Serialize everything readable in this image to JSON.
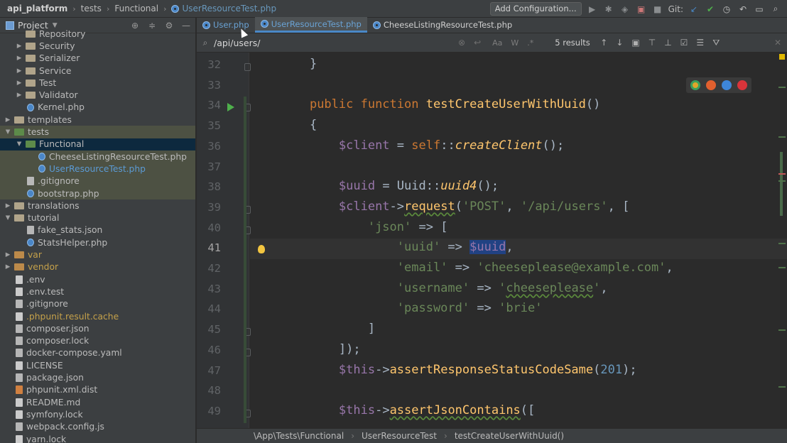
{
  "topbar": {
    "breadcrumbs": [
      "api_platform",
      "tests",
      "Functional",
      "UserResourceTest.php"
    ],
    "add_config_label": "Add Configuration...",
    "git_label": "Git:"
  },
  "project_panel": {
    "title": "Project",
    "rows": [
      {
        "label": "Repository",
        "kind": "folder",
        "depth": 2,
        "arrow": "",
        "color": "normal"
      },
      {
        "label": "Security",
        "kind": "folder",
        "depth": 2,
        "arrow": "▶",
        "color": "normal"
      },
      {
        "label": "Serializer",
        "kind": "folder",
        "depth": 2,
        "arrow": "▶",
        "color": "normal"
      },
      {
        "label": "Service",
        "kind": "folder",
        "depth": 2,
        "arrow": "▶",
        "color": "normal"
      },
      {
        "label": "Test",
        "kind": "folder",
        "depth": 2,
        "arrow": "▶",
        "color": "normal"
      },
      {
        "label": "Validator",
        "kind": "folder",
        "depth": 2,
        "arrow": "▶",
        "color": "normal"
      },
      {
        "label": "Kernel.php",
        "kind": "php",
        "depth": 2,
        "arrow": "",
        "color": "normal"
      },
      {
        "label": "templates",
        "kind": "folder",
        "depth": 1,
        "arrow": "▶",
        "color": "normal"
      },
      {
        "label": "tests",
        "kind": "folder-green",
        "depth": 1,
        "arrow": "▼",
        "color": "normal",
        "state": "highlight"
      },
      {
        "label": "Functional",
        "kind": "folder-green",
        "depth": 2,
        "arrow": "▼",
        "color": "normal",
        "state": "selected"
      },
      {
        "label": "CheeseListingResourceTest.php",
        "kind": "php",
        "depth": 3,
        "arrow": "",
        "color": "normal",
        "state": "highlight"
      },
      {
        "label": "UserResourceTest.php",
        "kind": "php",
        "depth": 3,
        "arrow": "",
        "color": "blue",
        "state": "highlight"
      },
      {
        "label": ".gitignore",
        "kind": "git",
        "depth": 2,
        "arrow": "",
        "color": "normal",
        "state": "highlight"
      },
      {
        "label": "bootstrap.php",
        "kind": "php",
        "depth": 2,
        "arrow": "",
        "color": "normal",
        "state": "highlight"
      },
      {
        "label": "translations",
        "kind": "folder",
        "depth": 1,
        "arrow": "▶",
        "color": "normal"
      },
      {
        "label": "tutorial",
        "kind": "folder",
        "depth": 1,
        "arrow": "▼",
        "color": "normal"
      },
      {
        "label": "fake_stats.json",
        "kind": "json",
        "depth": 2,
        "arrow": "",
        "color": "normal"
      },
      {
        "label": "StatsHelper.php",
        "kind": "php",
        "depth": 2,
        "arrow": "",
        "color": "normal"
      },
      {
        "label": "var",
        "kind": "folder-orange",
        "depth": 1,
        "arrow": "▶",
        "color": "yellow"
      },
      {
        "label": "vendor",
        "kind": "folder-orange",
        "depth": 1,
        "arrow": "▶",
        "color": "yellow"
      },
      {
        "label": ".env",
        "kind": "file",
        "depth": 1,
        "arrow": "",
        "color": "normal"
      },
      {
        "label": ".env.test",
        "kind": "file",
        "depth": 1,
        "arrow": "",
        "color": "normal"
      },
      {
        "label": ".gitignore",
        "kind": "git",
        "depth": 1,
        "arrow": "",
        "color": "normal"
      },
      {
        "label": ".phpunit.result.cache",
        "kind": "file",
        "depth": 1,
        "arrow": "",
        "color": "yellow"
      },
      {
        "label": "composer.json",
        "kind": "json",
        "depth": 1,
        "arrow": "",
        "color": "normal"
      },
      {
        "label": "composer.lock",
        "kind": "json",
        "depth": 1,
        "arrow": "",
        "color": "normal"
      },
      {
        "label": "docker-compose.yaml",
        "kind": "json",
        "depth": 1,
        "arrow": "",
        "color": "normal"
      },
      {
        "label": "LICENSE",
        "kind": "file",
        "depth": 1,
        "arrow": "",
        "color": "normal"
      },
      {
        "label": "package.json",
        "kind": "json",
        "depth": 1,
        "arrow": "",
        "color": "normal"
      },
      {
        "label": "phpunit.xml.dist",
        "kind": "orange",
        "depth": 1,
        "arrow": "",
        "color": "normal"
      },
      {
        "label": "README.md",
        "kind": "file",
        "depth": 1,
        "arrow": "",
        "color": "normal"
      },
      {
        "label": "symfony.lock",
        "kind": "file",
        "depth": 1,
        "arrow": "",
        "color": "normal"
      },
      {
        "label": "webpack.config.js",
        "kind": "json",
        "depth": 1,
        "arrow": "",
        "color": "normal"
      },
      {
        "label": "yarn.lock",
        "kind": "file",
        "depth": 1,
        "arrow": "",
        "color": "normal"
      }
    ]
  },
  "tabs": [
    {
      "label": "User.php",
      "active": false
    },
    {
      "label": "UserResourceTest.php",
      "active": true
    },
    {
      "label": "CheeseListingResourceTest.php",
      "active": false
    }
  ],
  "find": {
    "query": "/api/users/",
    "results": "5 results",
    "options": [
      "Aa",
      "W",
      ".*"
    ]
  },
  "editor": {
    "current_line": 41,
    "lines": [
      {
        "n": "32",
        "html": "    }"
      },
      {
        "n": "33",
        "html": ""
      },
      {
        "n": "34",
        "html": "    <span class=\"kw\">public function </span><span class=\"fn\">testCreateUserWithUuid</span>()"
      },
      {
        "n": "35",
        "html": "    {"
      },
      {
        "n": "36",
        "html": "        <span class=\"var\">$client</span> = <span class=\"kw\">self</span>::<span class=\"it\">createClient</span>();"
      },
      {
        "n": "37",
        "html": ""
      },
      {
        "n": "38",
        "html": "        <span class=\"var\">$uuid</span> = Uuid::<span class=\"it\">uuid4</span>();"
      },
      {
        "n": "39",
        "html": "        <span class=\"var\">$client</span>-&gt;<span class=\"fn wavy\">request</span>(<span class=\"str\">'POST'</span>, <span class=\"str\">'/api/users'</span>, ["
      },
      {
        "n": "40",
        "html": "            <span class=\"str\">'json'</span> =&gt; ["
      },
      {
        "n": "41",
        "html": "                <span class=\"str\">'uuid'</span> =&gt; <span class=\"var sel\">$uuid</span>,"
      },
      {
        "n": "42",
        "html": "                <span class=\"str\">'email'</span> =&gt; <span class=\"str\">'cheeseplease@example.com'</span>,"
      },
      {
        "n": "43",
        "html": "                <span class=\"str\">'username'</span> =&gt; <span class=\"str\">'<span class=\"wavy\">cheeseplease</span>'</span>,"
      },
      {
        "n": "44",
        "html": "                <span class=\"str\">'password'</span> =&gt; <span class=\"str\">'brie'</span>"
      },
      {
        "n": "45",
        "html": "            ]"
      },
      {
        "n": "46",
        "html": "        ]);"
      },
      {
        "n": "47",
        "html": "        <span class=\"var\">$this</span>-&gt;<span class=\"fn\">assertResponseStatusCodeSame</span>(<span class=\"num\">201</span>);"
      },
      {
        "n": "48",
        "html": ""
      },
      {
        "n": "49",
        "html": "        <span class=\"var\">$this</span>-&gt;<span class=\"fn wavy\">assertJsonContains</span>(["
      }
    ]
  },
  "breadcrumb": [
    "\\App\\Tests\\Functional",
    "UserResourceTest",
    "testCreateUserWithUuid()"
  ],
  "colors": {
    "accent": "#4a88c7",
    "selection": "#214283",
    "run_green": "#4fb04c"
  }
}
